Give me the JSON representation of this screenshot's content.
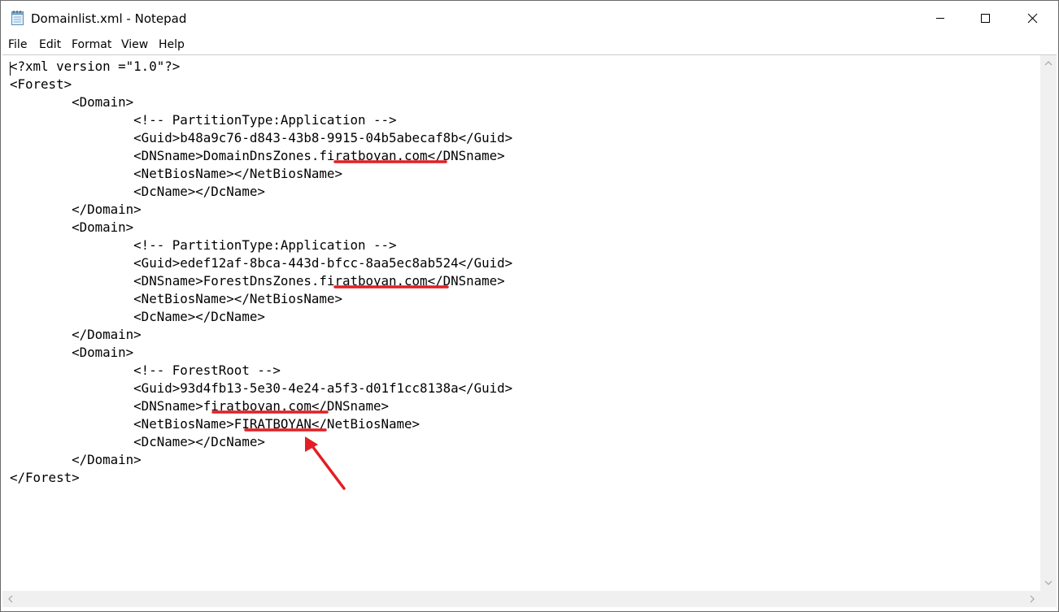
{
  "window": {
    "title": "Domainlist.xml - Notepad",
    "icon": "notepad-icon"
  },
  "controls": {
    "minimize": "minimize-icon",
    "maximize": "maximize-icon",
    "close": "close-icon"
  },
  "menu": [
    "File",
    "Edit",
    "Format",
    "View",
    "Help"
  ],
  "document": {
    "lines": [
      "<?xml version =\"1.0\"?>",
      "<Forest>",
      "        <Domain>",
      "                <!-- PartitionType:Application -->",
      "                <Guid>b48a9c76-d843-43b8-9915-04b5abecaf8b</Guid>",
      "                <DNSname>DomainDnsZones.firatboyan.com</DNSname>",
      "                <NetBiosName></NetBiosName>",
      "                <DcName></DcName>",
      "        </Domain>",
      "        <Domain>",
      "                <!-- PartitionType:Application -->",
      "                <Guid>edef12af-8bca-443d-bfcc-8aa5ec8ab524</Guid>",
      "                <DNSname>ForestDnsZones.firatboyan.com</DNSname>",
      "                <NetBiosName></NetBiosName>",
      "                <DcName></DcName>",
      "        </Domain>",
      "        <Domain>",
      "                <!-- ForestRoot -->",
      "                <Guid>93d4fb13-5e30-4e24-a5f3-d01f1cc8138a</Guid>",
      "                <DNSname>firatboyan.com</DNSname>",
      "                <NetBiosName>FIRATBOYAN</NetBiosName>",
      "                <DcName></DcName>",
      "        </Domain>",
      "</Forest>"
    ]
  },
  "annotation_color": "#e31e24",
  "text_color": "#000000"
}
